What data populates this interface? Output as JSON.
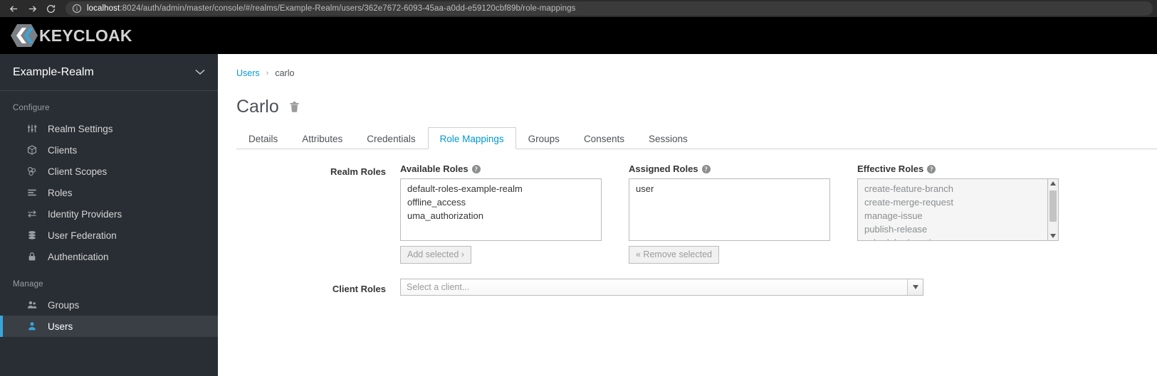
{
  "browser": {
    "back_icon": "arrow-left-icon",
    "forward_icon": "arrow-right-icon",
    "reload_icon": "reload-icon",
    "info_icon": "info-icon",
    "url_host": "localhost",
    "url_rest": ":8024/auth/admin/master/console/#/realms/Example-Realm/users/362e7672-6093-45aa-a0dd-e59120cbf89b/role-mappings"
  },
  "header": {
    "brand": "KEYCLOAK",
    "brand_color": "#39a5dc"
  },
  "sidebar": {
    "realm": "Example-Realm",
    "sections": [
      {
        "title": "Configure",
        "items": [
          {
            "label": "Realm Settings",
            "icon": "sliders-icon",
            "active": false
          },
          {
            "label": "Clients",
            "icon": "cube-icon",
            "active": false
          },
          {
            "label": "Client Scopes",
            "icon": "cubes-icon",
            "active": false
          },
          {
            "label": "Roles",
            "icon": "list-icon",
            "active": false
          },
          {
            "label": "Identity Providers",
            "icon": "exchange-icon",
            "active": false
          },
          {
            "label": "User Federation",
            "icon": "database-icon",
            "active": false
          },
          {
            "label": "Authentication",
            "icon": "lock-icon",
            "active": false
          }
        ]
      },
      {
        "title": "Manage",
        "items": [
          {
            "label": "Groups",
            "icon": "users-icon",
            "active": false
          },
          {
            "label": "Users",
            "icon": "user-icon",
            "active": true
          }
        ]
      }
    ]
  },
  "main": {
    "breadcrumb": {
      "parent": "Users",
      "separator": "›",
      "current": "carlo"
    },
    "page_title": "Carlo",
    "delete_icon": "trash-icon",
    "tabs": [
      {
        "label": "Details",
        "active": false
      },
      {
        "label": "Attributes",
        "active": false
      },
      {
        "label": "Credentials",
        "active": false
      },
      {
        "label": "Role Mappings",
        "active": true
      },
      {
        "label": "Groups",
        "active": false
      },
      {
        "label": "Consents",
        "active": false
      },
      {
        "label": "Sessions",
        "active": false
      }
    ],
    "realm_roles": {
      "row_label": "Realm Roles",
      "available": {
        "title": "Available Roles",
        "help_icon": "help-icon",
        "options": [
          "default-roles-example-realm",
          "offline_access",
          "uma_authorization"
        ],
        "button": "Add selected ›"
      },
      "assigned": {
        "title": "Assigned Roles",
        "help_icon": "help-icon",
        "options": [
          "user"
        ],
        "button": "« Remove selected"
      },
      "effective": {
        "title": "Effective Roles",
        "help_icon": "help-icon",
        "options": [
          "create-feature-branch",
          "create-merge-request",
          "manage-issue",
          "publish-release",
          "schedule-downtime"
        ],
        "scroll_up_icon": "caret-up-icon",
        "scroll_down_icon": "caret-down-icon",
        "has_scrollbar": true
      }
    },
    "client_roles": {
      "row_label": "Client Roles",
      "placeholder": "Select a client...",
      "value": "",
      "dropdown_icon": "caret-down-icon"
    }
  }
}
